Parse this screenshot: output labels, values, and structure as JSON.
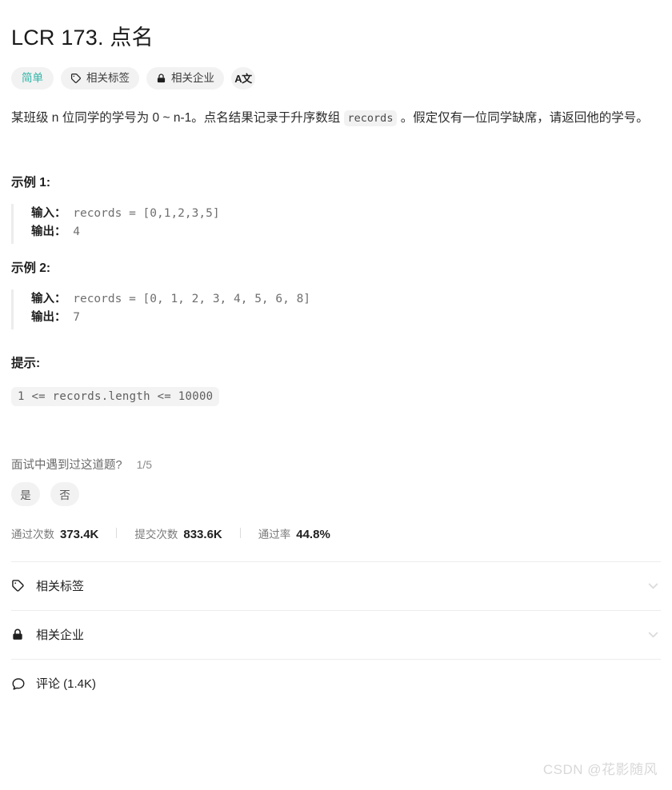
{
  "problem": {
    "title": "LCR 173. 点名",
    "badges": [
      {
        "label": "简单",
        "icon": "none",
        "kind": "difficulty"
      },
      {
        "label": "相关标签",
        "icon": "tag-icon",
        "kind": "normal"
      },
      {
        "label": "相关企业",
        "icon": "lock-icon",
        "kind": "normal"
      },
      {
        "label": "A文",
        "icon": "translate-icon",
        "kind": "icon-only"
      }
    ],
    "description": {
      "part1": "某班级 n 位同学的学号为 0 ~ n-1。点名结果记录于升序数组 ",
      "code": "records",
      "part2": " 。假定仅有一位同学缺席，请返回他的学号。"
    },
    "examples": [
      {
        "heading": "示例 1:",
        "input_label": "输入：",
        "input_value": " records = [0,1,2,3,5]",
        "output_label": "输出：",
        "output_value": " 4"
      },
      {
        "heading": "示例 2:",
        "input_label": "输入：",
        "input_value": " records = [0, 1, 2, 3, 4, 5, 6, 8]",
        "output_label": "输出：",
        "output_value": " 7"
      }
    ],
    "hints": {
      "heading": "提示:",
      "items": [
        "1 <= records.length <= 10000"
      ]
    }
  },
  "survey": {
    "question": "面试中遇到过这道题?",
    "count": "1/5",
    "yes_label": "是",
    "no_label": "否"
  },
  "stats": [
    {
      "label": "通过次数",
      "value": "373.4K"
    },
    {
      "label": "提交次数",
      "value": "833.6K"
    },
    {
      "label": "通过率",
      "value": "44.8%"
    }
  ],
  "sections": [
    {
      "label": "相关标签",
      "icon": "tag-icon"
    },
    {
      "label": "相关企业",
      "icon": "lock-icon"
    },
    {
      "label": "评论 (1.4K)",
      "icon": "comment-icon"
    }
  ],
  "watermark": "CSDN @花影随风",
  "colors": {
    "difficulty": "#2db3a6",
    "text": "#1f1f1f",
    "muted": "#7a7a7a",
    "chip_bg": "#f2f2f2",
    "divider": "#ededed"
  }
}
